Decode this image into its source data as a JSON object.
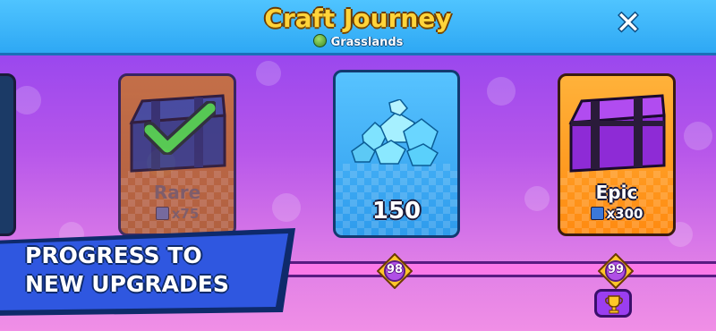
{
  "header": {
    "title": "Craft Journey",
    "subtitle": "Grasslands",
    "close_label": "✕"
  },
  "cards": {
    "rare": {
      "name": "Rare",
      "cost": "x75",
      "claimed": true
    },
    "gems": {
      "amount": "150"
    },
    "epic": {
      "name": "Epic",
      "cost": "x300"
    }
  },
  "milestones": {
    "first": "98",
    "second": "99"
  },
  "banner": {
    "line1": "PROGRESS TO",
    "line2": "NEW UPGRADES"
  },
  "icons": {
    "close": "close-icon",
    "globe": "grasslands-icon",
    "check": "checkmark-icon",
    "gems": "gems-icon",
    "chest": "chest-icon",
    "trophy": "trophy-icon",
    "tile": "tile-icon"
  },
  "colors": {
    "header": "#2ea8f4",
    "title": "#ffd43a",
    "track": "#fb79e8",
    "epic_card": "#ff8a10",
    "gem_card": "#3aa9f6",
    "banner": "#2f57e0",
    "milestone": "#e8a21a"
  }
}
